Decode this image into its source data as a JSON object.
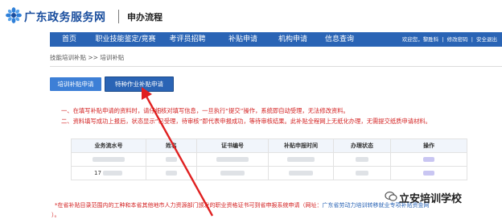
{
  "header": {
    "brand": "广东政务服务网",
    "subtitle": "申办流程"
  },
  "nav": {
    "items": [
      "首页",
      "职业技能鉴定/竞赛",
      "考评员招聘",
      "补贴申请",
      "机构申请",
      "信息查询"
    ],
    "welcome": "欢迎您，黎胜科",
    "edit_password": "修改密码",
    "logout": "安全退出"
  },
  "breadcrumb": "技能培训补贴 >> 培训补贴",
  "tabs": [
    "培训补贴申请",
    "特种作业补贴申请"
  ],
  "notice": [
    "一、在填写补贴申请的资料时，请仔细核对填写信息，一旦执行“提交”操作，系统即自动受理，无法修改资料。",
    "二、资料填写成功上报后，状态显示“已受理，待审核”即代表申报成功，等待审核结果。此补贴全程网上无纸化办理，无需提交纸质申请材料。"
  ],
  "table": {
    "headers": [
      "业务流水号",
      "姓名",
      "证书编号",
      "补贴申报时间",
      "办理状态",
      "操作"
    ],
    "row2_prefix": "17"
  },
  "footnote": {
    "text": "*在省补贴目录范围内的工种和本省其他地市人力资源部门颁发的职业资格证书可到省申报系统申请（网址：",
    "link": "广东省劳动力培训转移就业专项补贴资金网",
    "tail": "）。"
  },
  "watermark": "立安培训学校",
  "colors": {
    "nav_bg": "#2a64b5",
    "tab_bg": "#3d7fd6",
    "notice_red": "#d32020",
    "arrow_red": "#e02020"
  }
}
